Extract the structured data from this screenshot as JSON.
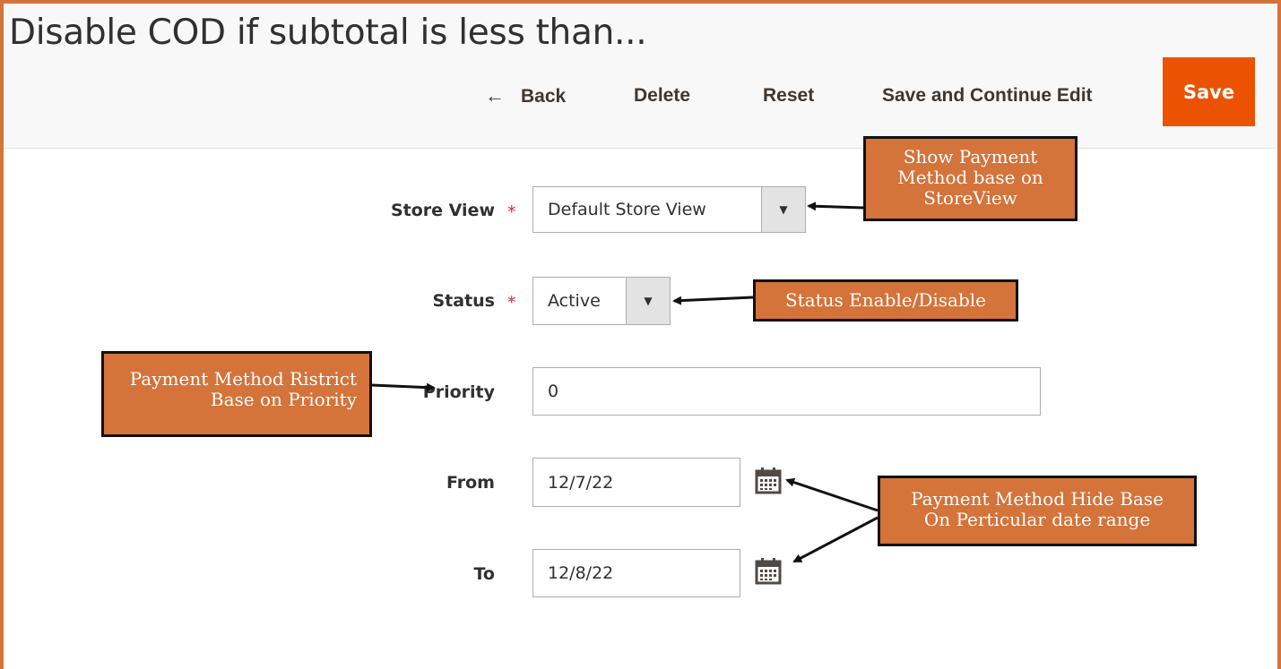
{
  "page": {
    "title": "Disable COD if subtotal is less than..."
  },
  "toolbar": {
    "back_label": "Back",
    "back_icon": "arrow-left-icon",
    "delete_label": "Delete",
    "reset_label": "Reset",
    "save_continue_label": "Save and Continue Edit",
    "save_label": "Save",
    "save_color": "#eb5202"
  },
  "form": {
    "store_view": {
      "label": "Store View",
      "required_mark": "*",
      "value": "Default Store View"
    },
    "status": {
      "label": "Status",
      "required_mark": "*",
      "value": "Active"
    },
    "priority": {
      "label": "Priority",
      "value": "0"
    },
    "from": {
      "label": "From",
      "value": "12/7/22",
      "icon": "calendar-icon"
    },
    "to": {
      "label": "To",
      "value": "12/8/22",
      "icon": "calendar-icon"
    }
  },
  "annotations": {
    "store_view": "Show Payment\nMethod base on\nStoreView",
    "status": "Status Enable/Disable",
    "priority": "Payment Method Ristrict\nBase on Priority",
    "date_range": "Payment Method Hide Base\nOn Perticular date range"
  },
  "colors": {
    "frame_border": "#d4733a",
    "callout_fill": "#d4733a",
    "required_star": "#e22626"
  }
}
